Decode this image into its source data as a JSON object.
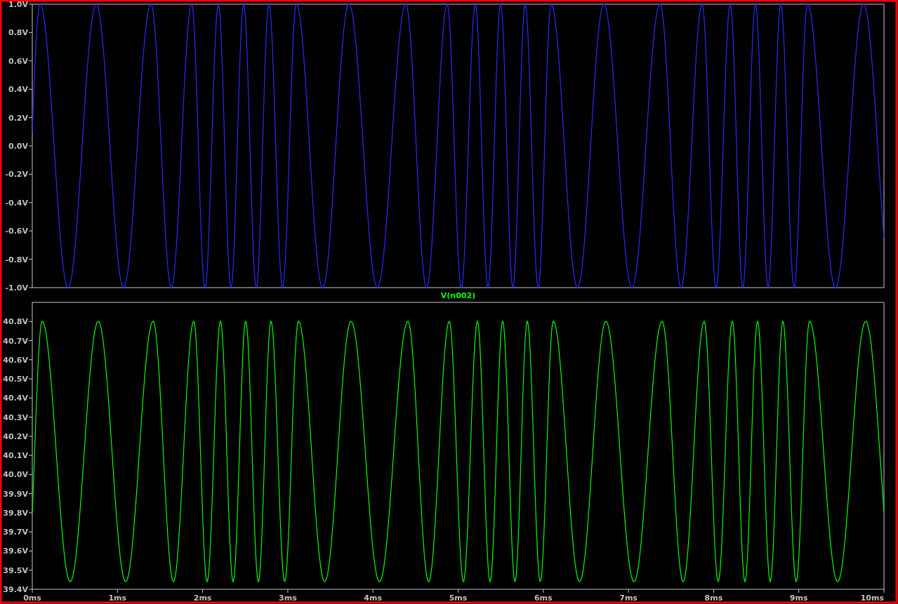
{
  "panes": [
    {
      "color": "#2a2aff",
      "y_ticks": [
        "1.0V",
        "0.8V",
        "0.6V",
        "0.4V",
        "0.2V",
        "0.0V",
        "-0.2V",
        "-0.4V",
        "-0.6V",
        "-0.8V",
        "-1.0V"
      ]
    },
    {
      "title": "V(n002)",
      "color": "#00ff00",
      "y_ticks": [
        "40.8V",
        "40.7V",
        "40.6V",
        "40.5V",
        "40.4V",
        "40.3V",
        "40.2V",
        "40.1V",
        "40.0V",
        "39.9V",
        "39.8V",
        "39.7V",
        "39.6V",
        "39.5V",
        "39.4V"
      ]
    }
  ],
  "x_ticks": [
    "0ms",
    "1ms",
    "2ms",
    "3ms",
    "4ms",
    "5ms",
    "6ms",
    "7ms",
    "8ms",
    "9ms",
    "10ms"
  ]
}
